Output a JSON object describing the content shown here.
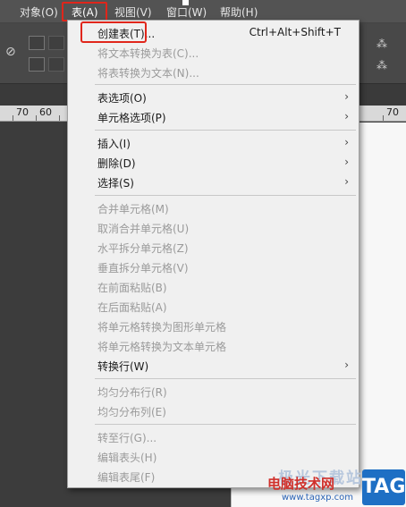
{
  "menubar": {
    "items": [
      "对象(O)",
      "表(A)",
      "视图(V)",
      "窗口(W)",
      "帮助(H)"
    ]
  },
  "ruler": {
    "numbers": [
      "70",
      "60",
      "70"
    ]
  },
  "menu": {
    "items": [
      {
        "label": "创建表(T)...",
        "shortcut": "Ctrl+Alt+Shift+T",
        "enabled": true,
        "submenu": false
      },
      {
        "label": "将文本转换为表(C)...",
        "enabled": false,
        "submenu": false
      },
      {
        "label": "将表转换为文本(N)...",
        "enabled": false,
        "submenu": false
      },
      {
        "label": "表选项(O)",
        "enabled": true,
        "submenu": true
      },
      {
        "label": "单元格选项(P)",
        "enabled": true,
        "submenu": true
      },
      {
        "label": "插入(I)",
        "enabled": true,
        "submenu": true
      },
      {
        "label": "删除(D)",
        "enabled": true,
        "submenu": true
      },
      {
        "label": "选择(S)",
        "enabled": true,
        "submenu": true
      },
      {
        "label": "合并单元格(M)",
        "enabled": false,
        "submenu": false
      },
      {
        "label": "取消合并单元格(U)",
        "enabled": false,
        "submenu": false
      },
      {
        "label": "水平拆分单元格(Z)",
        "enabled": false,
        "submenu": false
      },
      {
        "label": "垂直拆分单元格(V)",
        "enabled": false,
        "submenu": false
      },
      {
        "label": "在前面粘贴(B)",
        "enabled": false,
        "submenu": false
      },
      {
        "label": "在后面粘贴(A)",
        "enabled": false,
        "submenu": false
      },
      {
        "label": "将单元格转换为图形单元格",
        "enabled": false,
        "submenu": false
      },
      {
        "label": "将单元格转换为文本单元格",
        "enabled": false,
        "submenu": false
      },
      {
        "label": "转换行(W)",
        "enabled": true,
        "submenu": true
      },
      {
        "label": "均匀分布行(R)",
        "enabled": false,
        "submenu": false
      },
      {
        "label": "均匀分布列(E)",
        "enabled": false,
        "submenu": false
      },
      {
        "label": "转至行(G)...",
        "enabled": false,
        "submenu": false
      },
      {
        "label": "编辑表头(H)",
        "enabled": false,
        "submenu": false
      },
      {
        "label": "编辑表尾(F)",
        "enabled": false,
        "submenu": false
      }
    ],
    "submenu_arrow": "›"
  },
  "watermark": {
    "ghost_text": "极光下载站",
    "site_name": "电脑技术网",
    "url": "www.tagxp.com",
    "badge": "TAG"
  },
  "colors": {
    "highlight_box": "#e0261b",
    "menu_bg": "#f0f0f0",
    "disabled_text": "#9a9a9a"
  }
}
